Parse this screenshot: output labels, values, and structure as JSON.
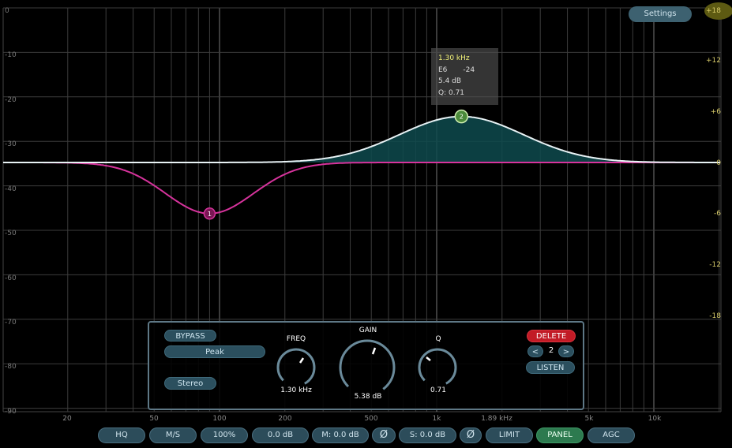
{
  "settings_label": "Settings",
  "tooltip": {
    "freq": "1.30 kHz",
    "note": "E6",
    "cents": "-24",
    "gain": "5.4 dB",
    "q": "Q: 0.71"
  },
  "left_axis": [
    "0",
    "-10",
    "-20",
    "-30",
    "-40",
    "-50",
    "-60",
    "-70",
    "-80",
    "-90"
  ],
  "right_axis": [
    "+18",
    "+12",
    "+6",
    "0",
    "-6",
    "-12",
    "-18"
  ],
  "freq_axis": [
    "20",
    "50",
    "100",
    "200",
    "500",
    "1k",
    "1.89 kHz",
    "5k",
    "10k"
  ],
  "bands": [
    {
      "number": "1",
      "freq_hz": 90,
      "gain_db": -6,
      "color": "#d6339c"
    },
    {
      "number": "2",
      "freq_hz": 1300,
      "gain_db": 5.4,
      "color": "#8ecf5a"
    }
  ],
  "panel": {
    "bypass": "BYPASS",
    "type": "Peak",
    "channel": "Stereo",
    "freq_label": "FREQ",
    "freq_value": "1.30 kHz",
    "gain_label": "GAIN",
    "gain_value": "5.38 dB",
    "q_label": "Q",
    "q_value": "0.71",
    "delete": "DELETE",
    "prev": "<",
    "band_number": "2",
    "next": ">",
    "listen": "LISTEN"
  },
  "bottom_bar": {
    "hq": "HQ",
    "ms": "M/S",
    "zoom": "100%",
    "gain": "0.0 dB",
    "m_gain": "M: 0.0 dB",
    "phase1": "Ø",
    "s_gain": "S: 0.0 dB",
    "phase2": "Ø",
    "limit": "LIMIT",
    "panel": "PANEL",
    "agc": "AGC"
  },
  "colors": {
    "accent_fill": "#0e4a4e",
    "white_curve": "#e8f2f5",
    "pink_curve": "#d6339c",
    "band2": "#8ecf5a"
  }
}
